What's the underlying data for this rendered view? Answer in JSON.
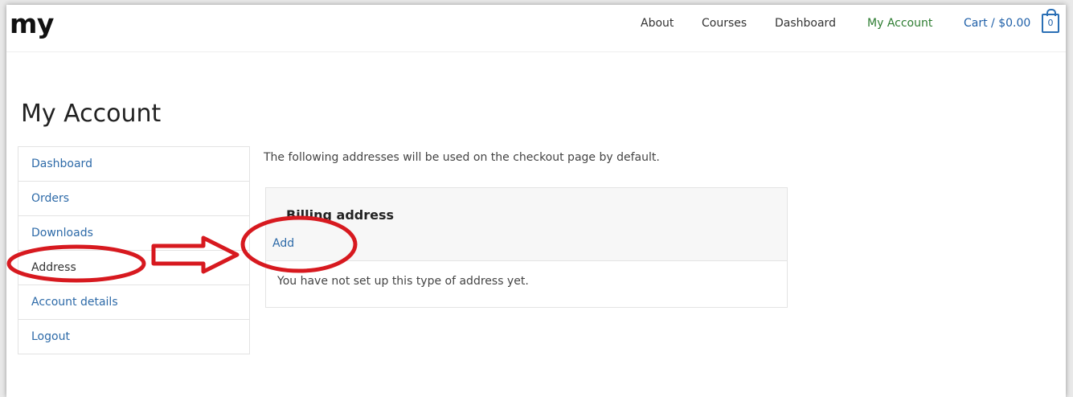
{
  "header": {
    "logo": "my",
    "nav": [
      {
        "label": "About"
      },
      {
        "label": "Courses"
      },
      {
        "label": "Dashboard"
      },
      {
        "label": "My Account"
      }
    ],
    "cart_label": "Cart / $0.00",
    "cart_count": "0"
  },
  "page": {
    "title": "My Account"
  },
  "sidebar": {
    "items": [
      {
        "label": "Dashboard"
      },
      {
        "label": "Orders"
      },
      {
        "label": "Downloads"
      },
      {
        "label": "Address"
      },
      {
        "label": "Account details"
      },
      {
        "label": "Logout"
      }
    ]
  },
  "content": {
    "intro": "The following addresses will be used on the checkout page by default.",
    "billing": {
      "title": "Billing address",
      "add_label": "Add",
      "empty_text": "You have not set up this type of address yet."
    }
  },
  "colors": {
    "link": "#2d6aa8",
    "active_nav": "#2e7d32",
    "annotation": "#d7191f"
  }
}
